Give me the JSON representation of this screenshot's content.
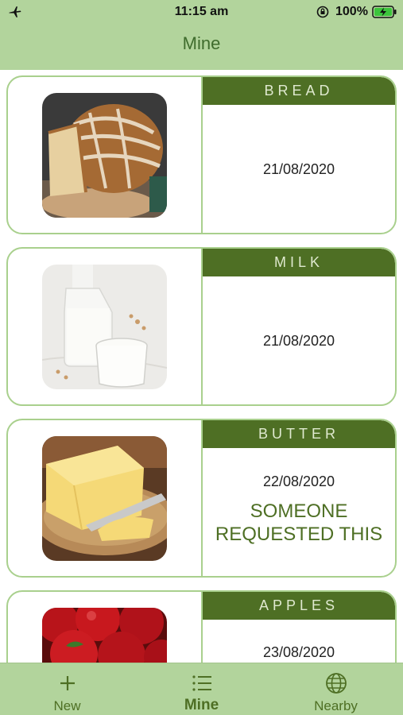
{
  "status_bar": {
    "time": "11:15 am",
    "battery_percent": "100%",
    "icons": [
      "airplane-icon",
      "rotation-lock-icon",
      "battery-charging-icon"
    ]
  },
  "header": {
    "title": "Mine"
  },
  "items": [
    {
      "category": "BREAD",
      "date": "21/08/2020",
      "image": "bread-photo"
    },
    {
      "category": "MILK",
      "date": "21/08/2020",
      "image": "milk-photo"
    },
    {
      "category": "BUTTER",
      "date": "22/08/2020",
      "image": "butter-photo",
      "request_line1": "SOMEONE",
      "request_line2": "REQUESTED THIS"
    },
    {
      "category": "APPLES",
      "date": "23/08/2020",
      "image": "apples-photo"
    }
  ],
  "tabbar": {
    "tabs": [
      {
        "label": "New",
        "icon": "plus-icon",
        "active": false
      },
      {
        "label": "Mine",
        "icon": "list-icon",
        "active": true
      },
      {
        "label": "Nearby",
        "icon": "globe-icon",
        "active": false
      }
    ]
  },
  "colors": {
    "header_bg": "#b2d49c",
    "accent": "#4e6f24",
    "card_border": "#a9d08d"
  }
}
